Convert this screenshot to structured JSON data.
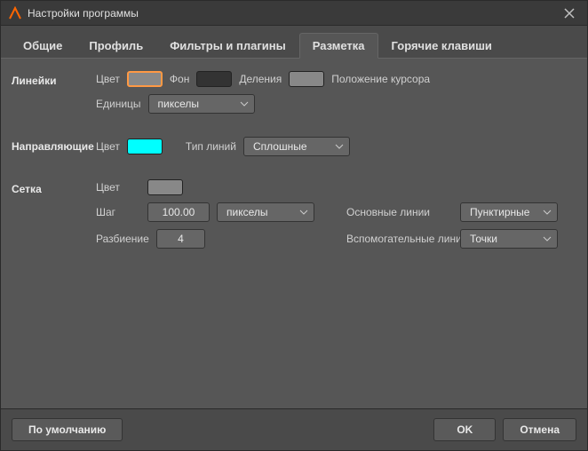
{
  "window": {
    "title": "Настройки программы"
  },
  "tabs": [
    {
      "label": "Общие"
    },
    {
      "label": "Профиль"
    },
    {
      "label": "Фильтры и плагины"
    },
    {
      "label": "Разметка"
    },
    {
      "label": "Горячие клавиши"
    }
  ],
  "rulers": {
    "section": "Линейки",
    "color_label": "Цвет",
    "bg_label": "Фон",
    "divisions_label": "Деления",
    "cursor_label": "Положение курсора",
    "units_label": "Единицы",
    "units_value": "пикселы",
    "color_value": "#888888",
    "bg_value": "#333333",
    "divisions_value": "#888888"
  },
  "guides": {
    "section": "Направляющие",
    "color_label": "Цвет",
    "color_value": "#00ffff",
    "linetype_label": "Тип линий",
    "linetype_value": "Сплошные"
  },
  "grid": {
    "section": "Сетка",
    "color_label": "Цвет",
    "color_value": "#888888",
    "step_label": "Шаг",
    "step_value": "100.00",
    "step_units": "пикселы",
    "subdiv_label": "Разбиение",
    "subdiv_value": "4",
    "main_lines_label": "Основные линии",
    "main_lines_value": "Пунктирные",
    "aux_lines_label": "Вспомогательные линии",
    "aux_lines_value": "Точки"
  },
  "footer": {
    "defaults": "По умолчанию",
    "ok": "OK",
    "cancel": "Отмена"
  }
}
